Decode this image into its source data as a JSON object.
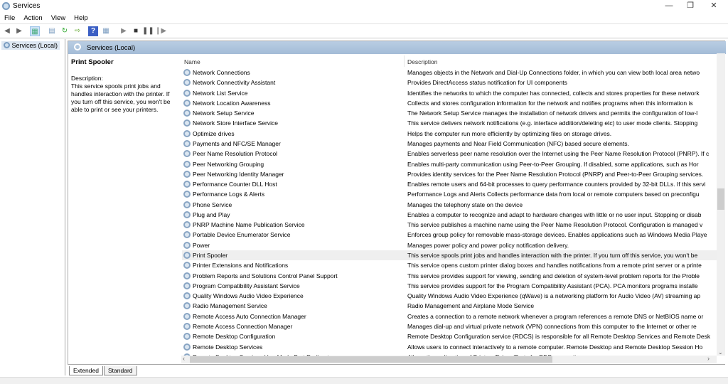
{
  "window": {
    "title": "Services",
    "minimize": "—",
    "maximize": "❐",
    "close": "✕"
  },
  "menu": [
    "File",
    "Action",
    "View",
    "Help"
  ],
  "toolbar": {
    "icons": [
      "back-arrow-icon",
      "forward-arrow-icon",
      "show-console-tree-icon",
      "properties-icon",
      "refresh-icon",
      "export-list-icon",
      "help-icon",
      "show-action-pane-icon",
      "start-service-icon",
      "stop-service-icon",
      "pause-service-icon",
      "resume-service-icon"
    ]
  },
  "tree": {
    "root": "Services (Local)"
  },
  "panel": {
    "header": "Services (Local)",
    "selected_name": "Print Spooler",
    "desc_label": "Description:",
    "desc_text": "This service spools print jobs and handles interaction with the printer. If you turn off this service, you won't be able to print or see your printers."
  },
  "columns": {
    "name": "Name",
    "description": "Description",
    "sort": "ascending"
  },
  "services": [
    {
      "name": "Network Connections",
      "description": "Manages objects in the Network and Dial-Up Connections folder, in which you can view both local area netwo"
    },
    {
      "name": "Network Connectivity Assistant",
      "description": "Provides DirectAccess status notification for UI components"
    },
    {
      "name": "Network List Service",
      "description": "Identifies the networks to which the computer has connected, collects and stores properties for these network"
    },
    {
      "name": "Network Location Awareness",
      "description": "Collects and stores configuration information for the network and notifies programs when this information is"
    },
    {
      "name": "Network Setup Service",
      "description": "The Network Setup Service manages the installation of network drivers and permits the configuration of low-l"
    },
    {
      "name": "Network Store Interface Service",
      "description": "This service delivers network notifications (e.g. interface addition/deleting etc) to user mode clients. Stopping"
    },
    {
      "name": "Optimize drives",
      "description": "Helps the computer run more efficiently by optimizing files on storage drives."
    },
    {
      "name": "Payments and NFC/SE Manager",
      "description": "Manages payments and Near Field Communication (NFC) based secure elements."
    },
    {
      "name": "Peer Name Resolution Protocol",
      "description": "Enables serverless peer name resolution over the Internet using the Peer Name Resolution Protocol (PNRP). If c"
    },
    {
      "name": "Peer Networking Grouping",
      "description": "Enables multi-party communication using Peer-to-Peer Grouping.  If disabled, some applications, such as Hor"
    },
    {
      "name": "Peer Networking Identity Manager",
      "description": "Provides identity services for the Peer Name Resolution Protocol (PNRP) and Peer-to-Peer Grouping services."
    },
    {
      "name": "Performance Counter DLL Host",
      "description": "Enables remote users and 64-bit processes to query performance counters provided by 32-bit DLLs. If this servi"
    },
    {
      "name": "Performance Logs & Alerts",
      "description": "Performance Logs and Alerts Collects performance data from local or remote computers based on preconfigu"
    },
    {
      "name": "Phone Service",
      "description": "Manages the telephony state on the device"
    },
    {
      "name": "Plug and Play",
      "description": "Enables a computer to recognize and adapt to hardware changes with little or no user input. Stopping or disab"
    },
    {
      "name": "PNRP Machine Name Publication Service",
      "description": "This service publishes a machine name using the Peer Name Resolution Protocol.  Configuration is managed v"
    },
    {
      "name": "Portable Device Enumerator Service",
      "description": "Enforces group policy for removable mass-storage devices. Enables applications such as Windows Media Playe"
    },
    {
      "name": "Power",
      "description": "Manages power policy and power policy notification delivery."
    },
    {
      "name": "Print Spooler",
      "description": "This service spools print jobs and handles interaction with the printer.  If you turn off this service, you won't be",
      "selected": true
    },
    {
      "name": "Printer Extensions and Notifications",
      "description": "This service opens custom printer dialog boxes and handles notifications from a remote print server or a printe"
    },
    {
      "name": "Problem Reports and Solutions Control Panel Support",
      "description": "This service provides support for viewing, sending and deletion of system-level problem reports for the Proble"
    },
    {
      "name": "Program Compatibility Assistant Service",
      "description": "This service provides support for the Program Compatibility Assistant (PCA).  PCA monitors programs installe"
    },
    {
      "name": "Quality Windows Audio Video Experience",
      "description": "Quality Windows Audio Video Experience (qWave) is a networking platform for Audio Video (AV) streaming ap"
    },
    {
      "name": "Radio Management Service",
      "description": "Radio Management and Airplane Mode Service"
    },
    {
      "name": "Remote Access Auto Connection Manager",
      "description": "Creates a connection to a remote network whenever a program references a remote DNS or NetBIOS name or"
    },
    {
      "name": "Remote Access Connection Manager",
      "description": "Manages dial-up and virtual private network (VPN) connections from this computer to the Internet or other re"
    },
    {
      "name": "Remote Desktop Configuration",
      "description": "Remote Desktop Configuration service (RDCS) is responsible for all Remote Desktop Services and Remote Desk"
    },
    {
      "name": "Remote Desktop Services",
      "description": "Allows users to connect interactively to a remote computer. Remote Desktop and Remote Desktop Session Ho"
    },
    {
      "name": "Remote Desktop Services UserMode Port Redirector",
      "description": "Allows the redirection of Printers/Drives/Ports for RDP connections"
    }
  ],
  "tabs": [
    "Extended",
    "Standard"
  ],
  "active_tab": "Extended",
  "scroll": {
    "vertical_position_percent": 48,
    "horizontal_visible_percent": 70
  }
}
